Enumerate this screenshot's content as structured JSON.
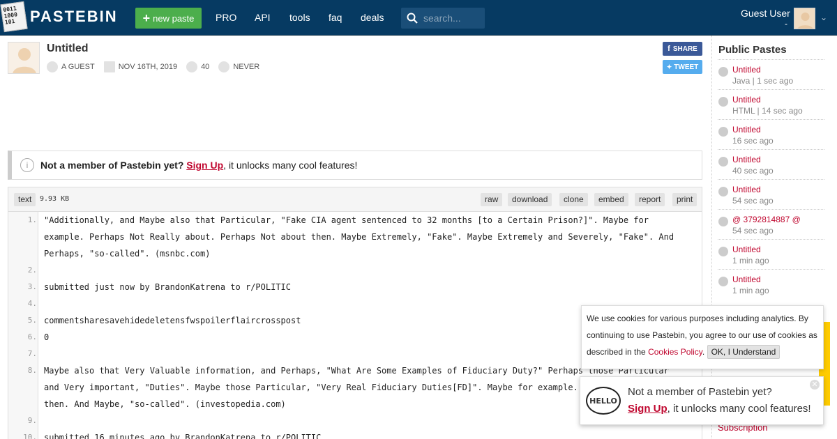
{
  "header": {
    "logo_text": "PASTEBIN",
    "logo_bits": [
      "0011",
      "1000",
      "101"
    ],
    "new_paste": "new paste",
    "nav": [
      "PRO",
      "API",
      "tools",
      "faq",
      "deals"
    ],
    "search_placeholder": "search...",
    "guest_user": "Guest User",
    "guest_sub": "-"
  },
  "paste": {
    "title": "Untitled",
    "author": "A GUEST",
    "date": "NOV 16TH, 2019",
    "views": "40",
    "expiry": "NEVER",
    "share": "SHARE",
    "tweet": "TWEET"
  },
  "notice": {
    "lead": "Not a member of Pastebin yet?",
    "link": "Sign Up",
    "rest": ", it unlocks many cool features!"
  },
  "codebar": {
    "format": "text",
    "size": "9.93 KB",
    "actions": [
      "raw",
      "download",
      "clone",
      "embed",
      "report",
      "print"
    ]
  },
  "code_lines": [
    {
      "n": "1.",
      "t": "\"Additionally, and Maybe also that Particular, \"Fake CIA agent sentenced to 32 months [to a Certain Prison?]\". Maybe for example. Perhaps Not Really about. Perhaps Not about then. Maybe Extremely, \"Fake\". Maybe Extremely and Severely, \"Fake\". And Perhaps, \"so-called\". (msnbc.com)"
    },
    {
      "n": "2.",
      "t": ""
    },
    {
      "n": "3.",
      "t": "submitted just now by BrandonKatrena to r/POLITIC"
    },
    {
      "n": "4.",
      "t": ""
    },
    {
      "n": "5.",
      "t": "commentsharesavehidedeletensfwspoilerflaircrosspost"
    },
    {
      "n": "6.",
      "t": "0"
    },
    {
      "n": "7.",
      "t": ""
    },
    {
      "n": "8.",
      "t": "Maybe also that Very Valuable information, and Perhaps, \"What Are Some Examples of Fiduciary Duty?\" Perhaps those Particular and Very important, \"Duties\". Maybe those Particular, \"Very Real Fiduciary Duties[FD]\". Maybe for example. And Perhaps Not then. And Maybe, \"so-called\". (investopedia.com)"
    },
    {
      "n": "9.",
      "t": ""
    },
    {
      "n": "10.",
      "t": "submitted 16 minutes ago by BrandonKatrena to r/POLITIC"
    }
  ],
  "sidebar": {
    "title": "Public Pastes",
    "items": [
      {
        "name": "Untitled",
        "sub": "Java | 1 sec ago"
      },
      {
        "name": "Untitled",
        "sub": "HTML | 14 sec ago"
      },
      {
        "name": "Untitled",
        "sub": "16 sec ago"
      },
      {
        "name": "Untitled",
        "sub": "40 sec ago"
      },
      {
        "name": "Untitled",
        "sub": "54 sec ago"
      },
      {
        "name": "@ 3792814887 @",
        "sub": "54 sec ago"
      },
      {
        "name": "Untitled",
        "sub": "1 min ago"
      },
      {
        "name": "Untitled",
        "sub": "1 min ago"
      }
    ],
    "subscription": "Subscription"
  },
  "cookie": {
    "text": "We use cookies for various purposes including analytics. By continuing to use Pastebin, you agree to our use of cookies as described in the",
    "link": "Cookies Policy",
    "period": ".",
    "ok": "OK, I Understand"
  },
  "popup": {
    "hello": "HELLO",
    "line1": "Not a member of Pastebin yet?",
    "link": "Sign Up",
    "rest": ", it unlocks many cool features!",
    "close": "✕"
  },
  "colors": {
    "header_bg": "#063a62",
    "accent_green": "#4cae4c",
    "link_red": "#c0072f",
    "facebook": "#3b5998",
    "twitter": "#55acee"
  }
}
